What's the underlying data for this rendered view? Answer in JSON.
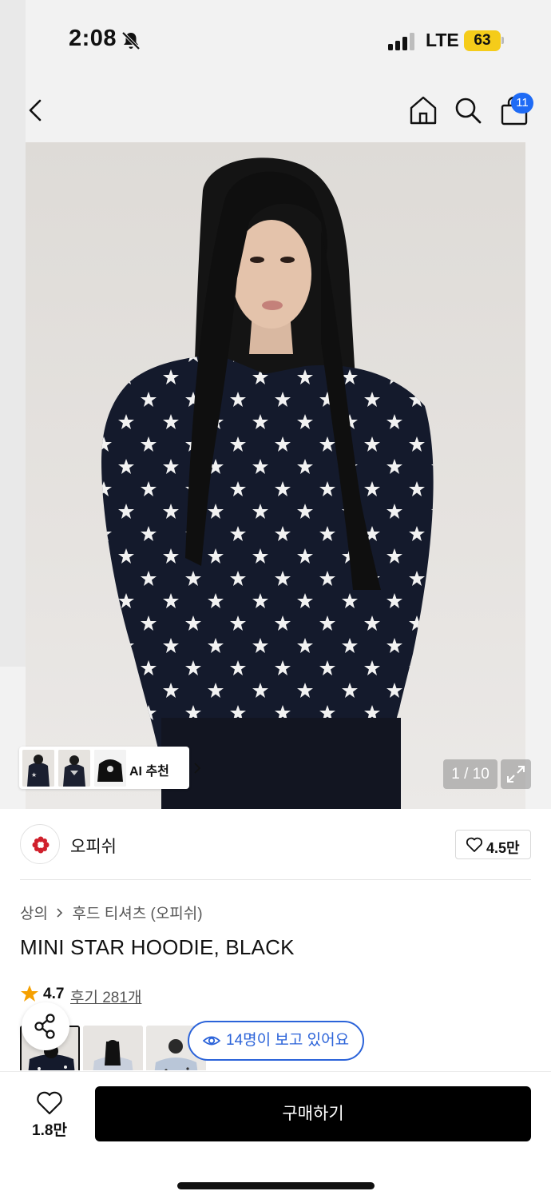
{
  "status_bar": {
    "time": "2:08",
    "network": "LTE",
    "battery": "63"
  },
  "nav": {
    "cart_badge": "11"
  },
  "hero": {
    "ai_label": "AI 추천",
    "pager": "1 / 10"
  },
  "brand": {
    "name": "오피쉬",
    "likes": "4.5만"
  },
  "breadcrumb": {
    "level1": "상의",
    "level2": "후드 티셔츠 (오피쉬)"
  },
  "product": {
    "title": "MINI STAR HOODIE, BLACK",
    "rating": "4.7",
    "reviews": "후기 281개",
    "viewers": "14명이 보고 있어요"
  },
  "bottom": {
    "wish_count": "1.8만",
    "buy_label": "구매하기"
  },
  "colors": {
    "accent_blue": "#2b63d9",
    "badge_blue": "#1f6bf5",
    "star": "#f5a000",
    "battery": "#f5cc1a"
  }
}
